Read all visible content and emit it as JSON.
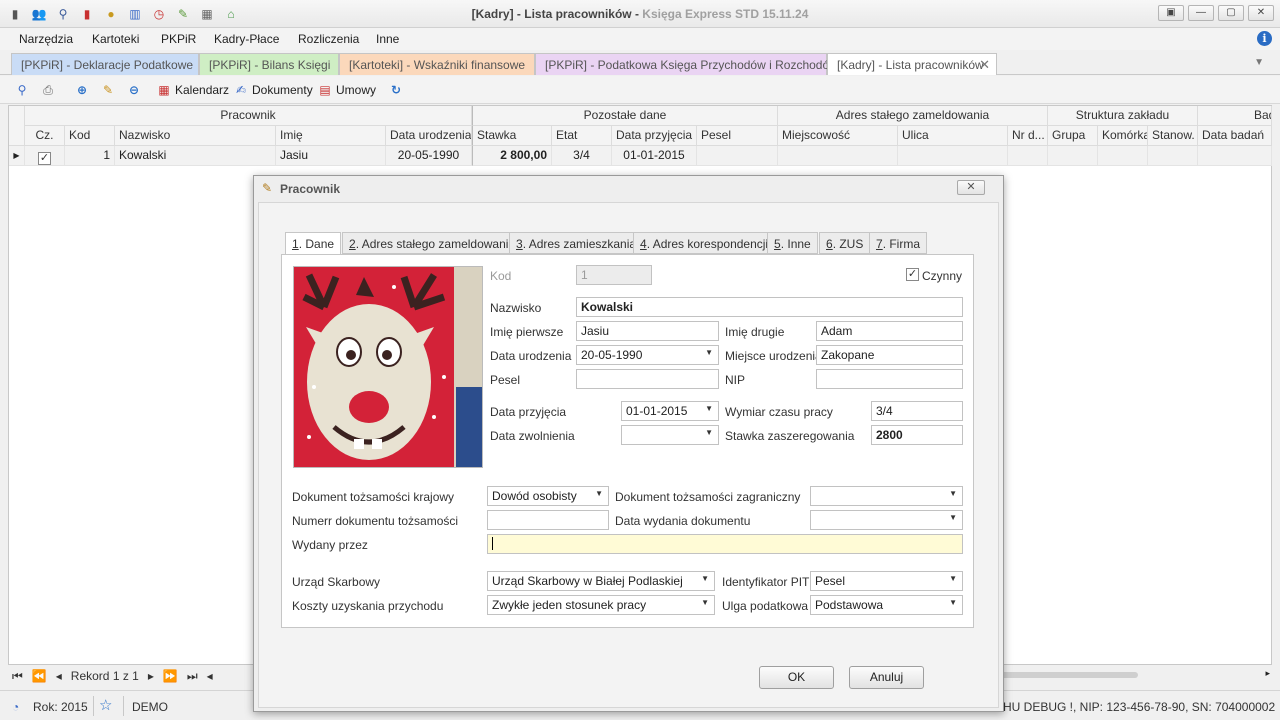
{
  "window": {
    "title_main": "[Kadry] - Lista pracowników",
    "title_app": "Księga Express STD 15.11.24",
    "controls": [
      "▣",
      "—",
      "▢",
      "✕"
    ]
  },
  "toolbar_icons": [
    "book-icon",
    "users-icon",
    "search-users-icon",
    "book-red-icon",
    "coins-icon",
    "chart-icon",
    "clock-icon",
    "edit-icon",
    "calculator-icon",
    "home-icon"
  ],
  "menu": [
    "Narzędzia",
    "Kartoteki",
    "PKPiR",
    "Kadry-Płace",
    "Rozliczenia",
    "Inne"
  ],
  "doc_tabs": [
    {
      "label": "[PKPiR] - Deklaracje Podatkowe",
      "color": "#c9dcf6"
    },
    {
      "label": "[PKPiR] - Bilans Księgi",
      "color": "#cfeec4"
    },
    {
      "label": "[Kartoteki] - Wskaźniki finansowe",
      "color": "#fbd8bb"
    },
    {
      "label": "[PKPiR] - Podatkowa Księga Przychodów i Rozchodów",
      "color": "#ead4f3"
    },
    {
      "label": "[Kadry] - Lista pracowników",
      "color": "#ffffff"
    }
  ],
  "actions": {
    "kalendarz": "Kalendarz",
    "dokumenty": "Dokumenty",
    "umowy": "Umowy"
  },
  "grid": {
    "groups": [
      "Pracownik",
      "Pozostałe dane",
      "Adres stałego zameldowania",
      "Struktura zakładu",
      "Badania"
    ],
    "columns": [
      "Cz.",
      "Kod",
      "Nazwisko",
      "Imię",
      "Data urodzenia",
      "Stawka",
      "Etat",
      "Data przyjęcia",
      "Pesel",
      "Miejscowość",
      "Ulica",
      "Nr d...",
      "Grupa",
      "Komórka",
      "Stanow.",
      "Data badań"
    ],
    "row": {
      "kod": "1",
      "nazwisko": "Kowalski",
      "imie": "Jasiu",
      "data_urodzenia": "20-05-1990",
      "stawka": "2 800,00",
      "etat": "3/4",
      "data_przyjecia": "01-01-2015"
    }
  },
  "record_nav": {
    "label": "Rekord 1 z 1"
  },
  "status": {
    "rok": "Rok: 2015",
    "demo": "DEMO",
    "debug": "HU DEBUG !, NIP: 123-456-78-90, SN: 704000002"
  },
  "dialog": {
    "title": "Pracownik",
    "tabs": [
      {
        "num": "1",
        "label": ". Dane"
      },
      {
        "num": "2",
        "label": ". Adres stałego zameldowania"
      },
      {
        "num": "3",
        "label": ". Adres zamieszkania"
      },
      {
        "num": "4",
        "label": ". Adres korespondencji"
      },
      {
        "num": "5",
        "label": ". Inne"
      },
      {
        "num": "6",
        "label": ". ZUS"
      },
      {
        "num": "7",
        "label": ". Firma"
      }
    ],
    "fields": {
      "kod_label": "Kod",
      "kod": "1",
      "czynny_label": "Czynny",
      "nazwisko_label": "Nazwisko",
      "nazwisko": "Kowalski",
      "imie1_label": "Imię pierwsze",
      "imie1": "Jasiu",
      "imie2_label": "Imię drugie",
      "imie2": "Adam",
      "data_ur_label": "Data urodzenia",
      "data_ur": "20-05-1990",
      "miejsce_ur_label": "Miejsce urodzenia",
      "miejsce_ur": "Zakopane",
      "pesel_label": "Pesel",
      "pesel": "",
      "nip_label": "NIP",
      "nip": "",
      "data_przyj_label": "Data przyjęcia",
      "data_przyj": "01-01-2015",
      "wymiar_label": "Wymiar czasu pracy",
      "wymiar": "3/4",
      "data_zwol_label": "Data zwolnienia",
      "data_zwol": "",
      "stawka_label": "Stawka zaszeregowania",
      "stawka": "2800",
      "dok_kraj_label": "Dokument tożsamości krajowy",
      "dok_kraj": "Dowód osobisty",
      "dok_zagr_label": "Dokument tożsamości zagraniczny",
      "dok_zagr": "",
      "nr_dok_label": "Numerr dokumentu tożsamości",
      "nr_dok": "",
      "data_wyd_label": "Data wydania dokumentu",
      "data_wyd": "",
      "wydany_label": "Wydany przez",
      "wydany": "",
      "urzad_label": "Urząd Skarbowy",
      "urzad": "Urząd Skarbowy w Białej Podlaskiej",
      "id_pit_label": "Identyfikator PIT",
      "id_pit": "Pesel",
      "koszty_label": "Koszty uzyskania przychodu",
      "koszty": "Zwykłe jeden stosunek pracy",
      "ulga_label": "Ulga podatkowa",
      "ulga": "Podstawowa"
    },
    "ok": "OK",
    "cancel": "Anuluj"
  }
}
